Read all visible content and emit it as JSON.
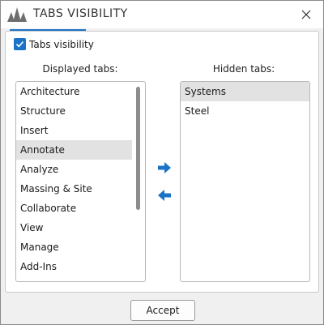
{
  "window": {
    "title": "TABS VISIBILITY",
    "logo_icon": "app-logo-icon",
    "close_icon": "close-icon"
  },
  "options": {
    "tabs_visibility_label": "Tabs visibility",
    "tabs_visibility_checked": true
  },
  "displayed": {
    "label": "Displayed tabs:",
    "items": [
      {
        "label": "Architecture",
        "selected": false
      },
      {
        "label": "Structure",
        "selected": false
      },
      {
        "label": "Insert",
        "selected": false
      },
      {
        "label": "Annotate",
        "selected": true
      },
      {
        "label": "Analyze",
        "selected": false
      },
      {
        "label": "Massing & Site",
        "selected": false
      },
      {
        "label": "Collaborate",
        "selected": false
      },
      {
        "label": "View",
        "selected": false
      },
      {
        "label": "Manage",
        "selected": false
      },
      {
        "label": "Add-Ins",
        "selected": false
      }
    ]
  },
  "hidden": {
    "label": "Hidden tabs:",
    "items": [
      {
        "label": "Systems",
        "selected": true
      },
      {
        "label": "Steel",
        "selected": false
      }
    ]
  },
  "actions": {
    "move_right_icon": "arrow-right-icon",
    "move_left_icon": "arrow-left-icon",
    "accept_label": "Accept"
  },
  "colors": {
    "accent": "#1a73c7",
    "selection": "#e2e2e2",
    "logo": "#6e6e6e"
  }
}
